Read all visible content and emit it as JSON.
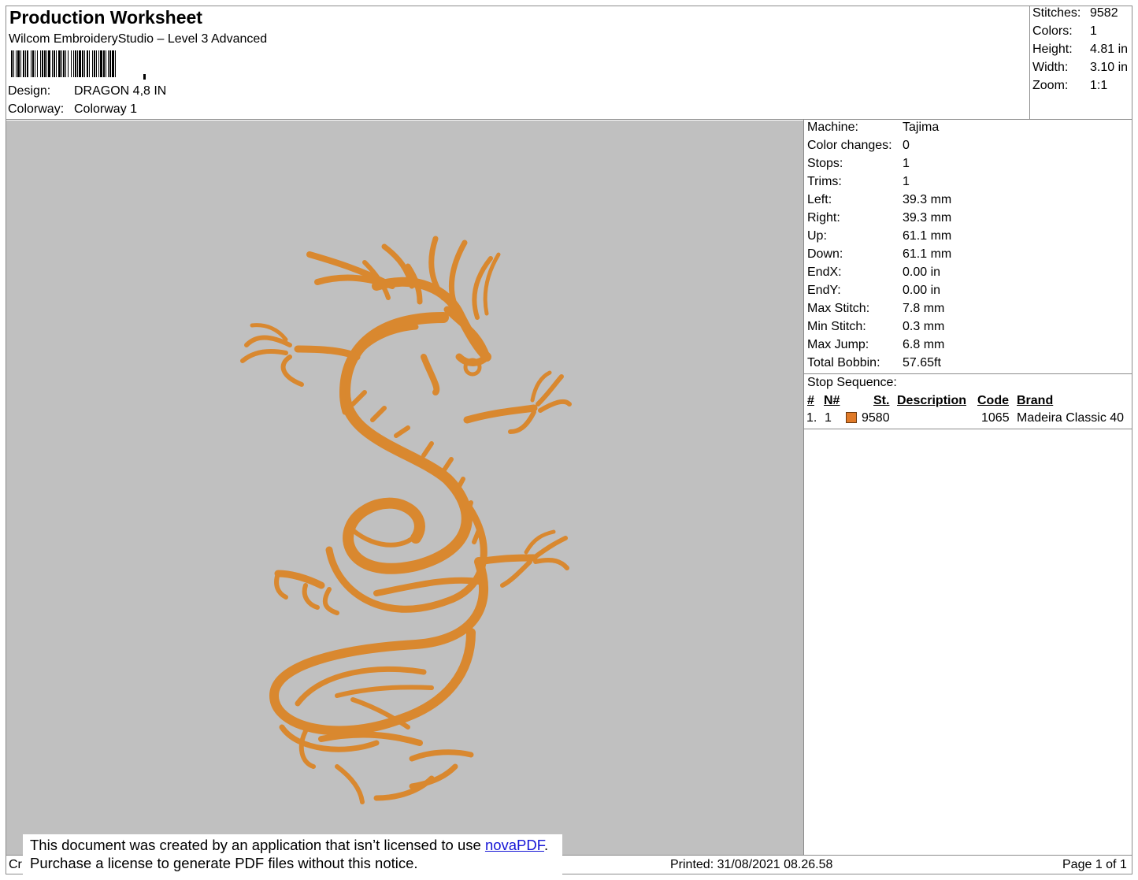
{
  "header": {
    "title": "Production Worksheet",
    "software": "Wilcom EmbroideryStudio – Level 3 Advanced",
    "design_label": "Design:",
    "design_value": "DRAGON 4,8 IN",
    "colorway_label": "Colorway:",
    "colorway_value": "Colorway 1"
  },
  "summary": [
    {
      "label": "Stitches:",
      "value": "9582"
    },
    {
      "label": "Colors:",
      "value": "1"
    },
    {
      "label": "Height:",
      "value": "4.81 in"
    },
    {
      "label": "Width:",
      "value": "3.10 in"
    },
    {
      "label": "Zoom:",
      "value": "1:1"
    }
  ],
  "machine_info": [
    {
      "label": "Machine:",
      "value": "Tajima"
    },
    {
      "label": "Color changes:",
      "value": "0"
    },
    {
      "label": "Stops:",
      "value": "1"
    },
    {
      "label": "Trims:",
      "value": "1"
    },
    {
      "label": "Left:",
      "value": "39.3 mm"
    },
    {
      "label": "Right:",
      "value": "39.3 mm"
    },
    {
      "label": "Up:",
      "value": "61.1 mm"
    },
    {
      "label": "Down:",
      "value": "61.1 mm"
    },
    {
      "label": "EndX:",
      "value": "0.00 in"
    },
    {
      "label": "EndY:",
      "value": "0.00 in"
    },
    {
      "label": "Max Stitch:",
      "value": "7.8 mm"
    },
    {
      "label": "Min Stitch:",
      "value": "0.3 mm"
    },
    {
      "label": "Max Jump:",
      "value": "6.8 mm"
    },
    {
      "label": "Total Bobbin:",
      "value": "57.65ft"
    }
  ],
  "stop_sequence": {
    "title": "Stop Sequence:",
    "headers": {
      "num": "#",
      "n": "N#",
      "st": "St.",
      "description": "Description",
      "code": "Code",
      "brand": "Brand"
    },
    "rows": [
      {
        "num": "1.",
        "n": "1",
        "color": "#e07a28",
        "st": "9580",
        "description": "",
        "code": "1065",
        "brand": "Madeira Classic 40"
      }
    ]
  },
  "design": {
    "background_color": "#c0c0c0",
    "thread_color": "#d9882f"
  },
  "notice": {
    "line1_prefix": "This document was created by an application that isn’t licensed to use ",
    "link_text": "novaPDF",
    "line1_suffix": ".",
    "line2": "Purchase a license to generate PDF files without this notice."
  },
  "footer": {
    "left_text": "Cr",
    "printed": "Printed: 31/08/2021 08.26.58",
    "page": "Page 1 of 1"
  }
}
